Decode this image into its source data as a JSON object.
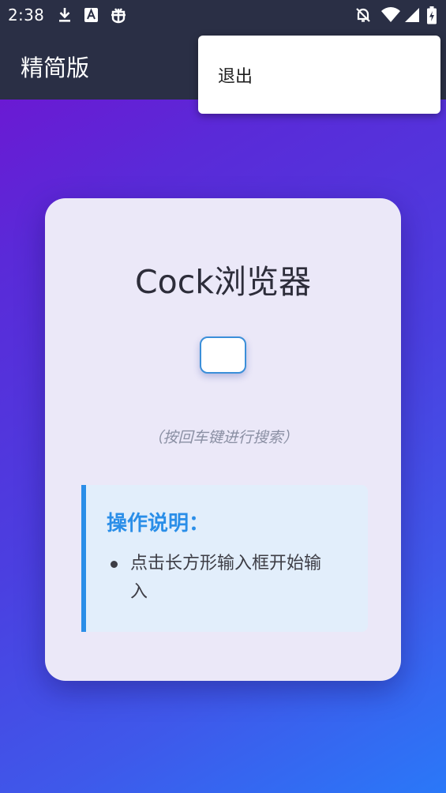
{
  "status_bar": {
    "time": "2:38",
    "left_icons": [
      "download-icon",
      "font-a-icon",
      "bug-icon"
    ],
    "right_icons": [
      "notifications-off-icon",
      "wifi-icon",
      "signal-icon",
      "battery-charging-icon"
    ]
  },
  "app_bar": {
    "title": "精简版"
  },
  "overflow_menu": {
    "items": [
      {
        "label": "退出"
      }
    ]
  },
  "card": {
    "title": "Cock浏览器",
    "search": {
      "value": "",
      "placeholder": ""
    },
    "hint": "（按回车键进行搜索）",
    "instructions": {
      "heading": "操作说明：",
      "items": [
        "点击长方形输入框开始输入"
      ]
    }
  },
  "colors": {
    "bar_background": "#2a2f45",
    "gradient_start": "#7410d0",
    "gradient_end": "#2a78f8",
    "accent": "#2a8ee8",
    "card_background": "#ebe8f8"
  }
}
